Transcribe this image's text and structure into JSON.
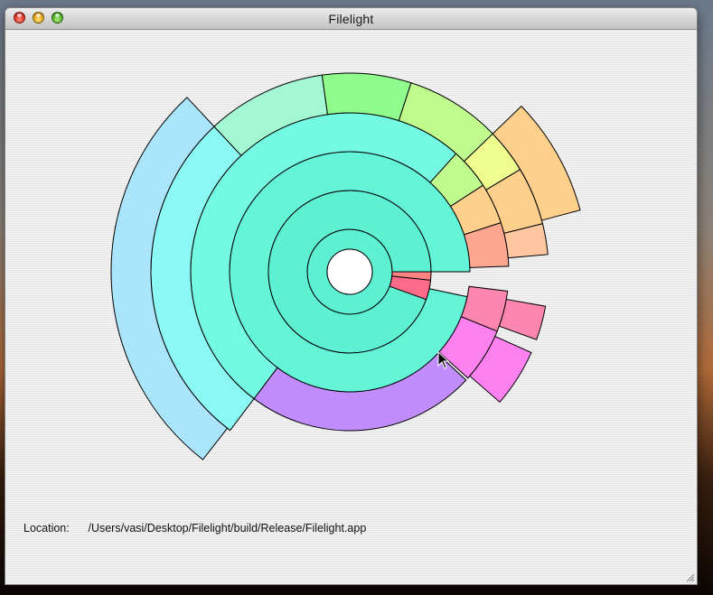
{
  "window": {
    "title": "Filelight"
  },
  "location": {
    "label": "Location:",
    "path": "/Users/vasi/Desktop/Filelight/build/Release/Filelight.app"
  },
  "icons": {
    "close": "close-button-icon",
    "minimize": "minimize-button-icon",
    "zoom": "zoom-button-icon",
    "resize": "resize-grip-icon",
    "cursor": "mouse-pointer-icon"
  },
  "colors": {
    "center_hole": "#ffffff",
    "inner_rings": "#5ef0d2",
    "ring2": "#64f5d8",
    "ring3": "#74fae2",
    "large_outer_cyan": "#8cf8f4",
    "light_blue": "#abe5fb",
    "mint": "#a3f8d3",
    "green": "#8ffc8b",
    "light_green": "#c0fb8e",
    "yellow_green": "#eefe8e",
    "orange": "#fed08c",
    "peach": "#fec7a0",
    "salmon": "#fda791",
    "coral": "#fd8282",
    "hot_pink": "#fd6a8a",
    "pink": "#fd86b0",
    "magenta": "#fd82f0",
    "purple": "#c18dfd"
  }
}
